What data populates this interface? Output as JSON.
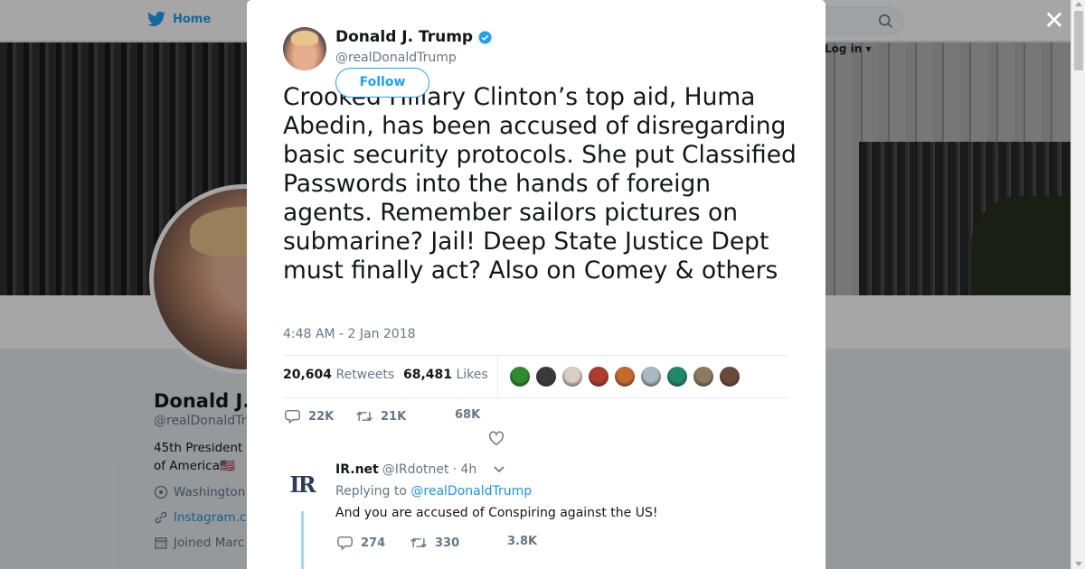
{
  "nav": {
    "home_label": "Home"
  },
  "header": {
    "login_label": "Log in"
  },
  "profile": {
    "name": "Donald J.",
    "handle": "@realDonaldTr",
    "bio_line1": "45th President",
    "bio_line2": "of America",
    "bio_flag": "🇺🇸",
    "location": "Washington",
    "link": "Instagram.c",
    "joined": "Joined Marc"
  },
  "modal": {
    "close_glyph": "✕",
    "tweet": {
      "author_name": "Donald J. Trump",
      "author_handle": "@realDonaldTrump",
      "follow_label": "Follow",
      "text": "Crooked Hillary Clinton’s top aid, Huma Abedin, has been accused of disregarding basic security protocols. She put Classified Passwords into the hands of foreign agents. Remember sailors pictures on submarine? Jail! Deep State Justice Dept must finally act? Also on Comey & others",
      "timestamp": "4:48 AM - 2 Jan 2018",
      "retweets_count": "20,604",
      "retweets_label": "Retweets",
      "likes_count": "68,481",
      "likes_label": "Likes",
      "reply_count": "22K",
      "retweet_count": "21K",
      "like_count": "68K",
      "liker_colors": [
        "#2e8b2e",
        "#3a3a3a",
        "#d9cfc4",
        "#b03a2e",
        "#c56a2a",
        "#aab8c2",
        "#1d8a6a",
        "#8c7b5a",
        "#6b4a3a"
      ]
    },
    "reply": {
      "logo_text": "IR",
      "author_name": "IR.net",
      "author_handle": "@IRdotnet",
      "time": "· 4h",
      "replying_prefix": "Replying to",
      "replying_to": "@realDonaldTrump",
      "text": "And you are accused of Conspiring against the US!",
      "reply_count": "274",
      "retweet_count": "330",
      "like_count": "3.8K"
    }
  },
  "colors": {
    "accent": "#1da1f2",
    "verified": "#1da1f2",
    "text": "#14171a",
    "muted": "#657786"
  }
}
